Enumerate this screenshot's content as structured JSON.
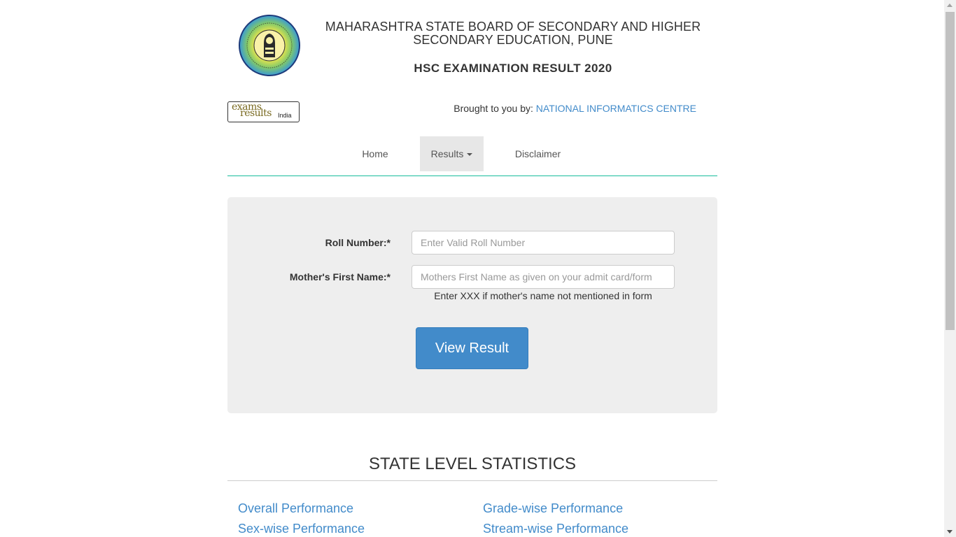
{
  "header": {
    "board_title_line1": "MAHARASHTRA STATE BOARD OF SECONDARY AND HIGHER",
    "board_title_line2": "SECONDARY EDUCATION, PUNE",
    "exam_title": "HSC EXAMINATION RESULT 2020",
    "logo_icon": "board-seal-icon",
    "partner_logo": {
      "exams": "exams",
      "results": "results",
      "india": "India"
    },
    "brought_by_prefix": "Brought to you by: ",
    "brought_by_link": "NATIONAL INFORMATICS CENTRE"
  },
  "nav": {
    "items": [
      {
        "label": "Home"
      },
      {
        "label": "Results",
        "active": true
      },
      {
        "label": "Disclaimer"
      }
    ],
    "accent_color": "#18bc9c"
  },
  "form": {
    "roll_label": "Roll Number:*",
    "roll_placeholder": "Enter Valid Roll Number",
    "roll_value": "",
    "mother_label": "Mother's First Name:*",
    "mother_placeholder": "Mothers First Name as given on your admit card/form",
    "mother_value": "",
    "hint": "Enter XXX if mother's name not mentioned in form",
    "submit_label": "View Result",
    "submit_color": "#428bca"
  },
  "stats": {
    "title": "STATE LEVEL STATISTICS",
    "links": [
      "Overall Performance",
      "Grade-wise Performance",
      "Sex-wise Performance",
      "Stream-wise Performance"
    ],
    "link_color": "#428bca"
  }
}
